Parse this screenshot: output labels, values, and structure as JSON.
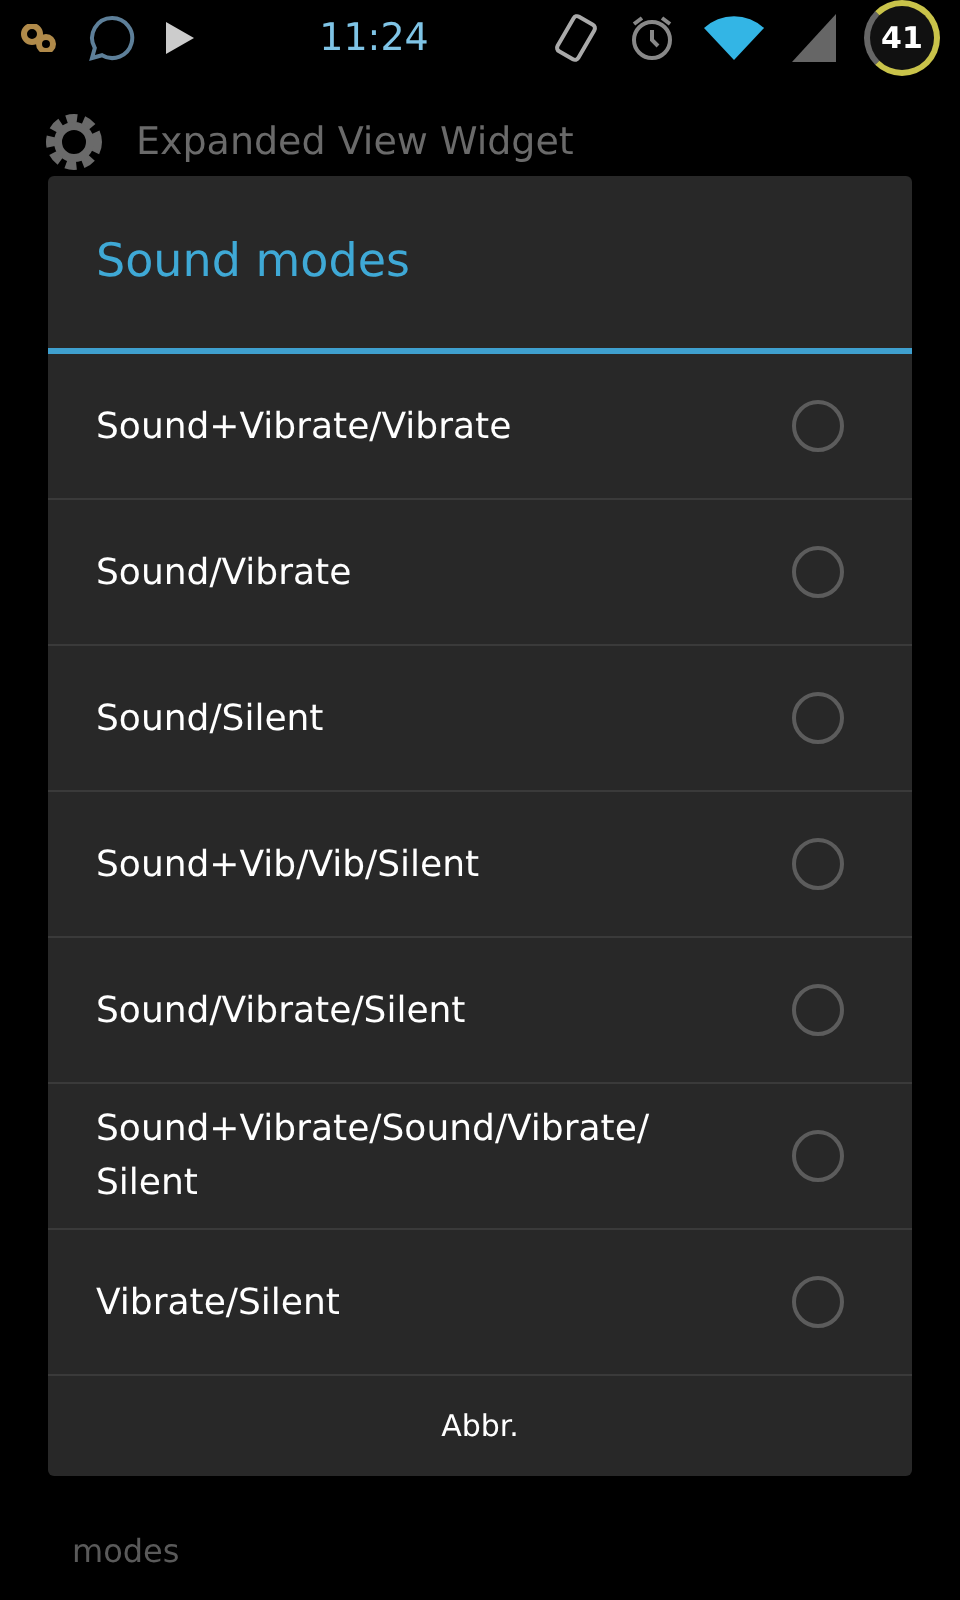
{
  "status_bar": {
    "time": "11:24",
    "battery": "41"
  },
  "background": {
    "title": "Expanded View Widget",
    "description": "modes"
  },
  "dialog": {
    "title": "Sound modes",
    "options": [
      {
        "label": "Sound+Vibrate/Vibrate",
        "selected": false
      },
      {
        "label": "Sound/Vibrate",
        "selected": false
      },
      {
        "label": "Sound/Silent",
        "selected": false
      },
      {
        "label": "Sound+Vib/Vib/Silent",
        "selected": false
      },
      {
        "label": "Sound/Vibrate/Silent",
        "selected": false
      },
      {
        "label": "Sound+Vibrate/Sound/Vibrate/Silent",
        "selected": false
      },
      {
        "label": "Vibrate/Silent",
        "selected": false
      }
    ],
    "buttons": [
      "Abbr."
    ]
  }
}
